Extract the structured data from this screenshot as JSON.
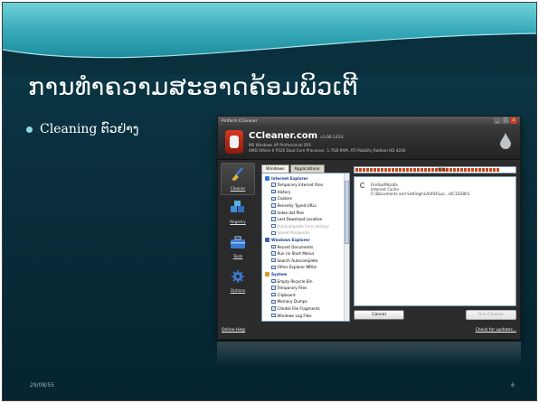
{
  "slide": {
    "title": "ການທຳຄວາມສະອາດຄ້ອມພິວເຕີ",
    "bullet": "Cleaning ຕົວຢ່າງ",
    "date": "29/08/55",
    "page_number": "6"
  },
  "app": {
    "title": "Piriform CCleaner",
    "brand": "CCleaner.com",
    "version": "v3.06.1433",
    "sysinfo_os": "MS Windows XP Professional SP3",
    "sysinfo_hw": "AMD Athlon II P320 Dual-Core Processor, 1.7GB RAM, ATI Mobility Radeon HD 4200",
    "window_buttons": [
      "_",
      "□",
      "x"
    ],
    "sidebar": [
      {
        "label": "Cleaner",
        "icon": "broom-icon",
        "active": true
      },
      {
        "label": "Registry",
        "icon": "registry-cubes-icon",
        "active": false
      },
      {
        "label": "Tools",
        "icon": "toolbox-icon",
        "active": false
      },
      {
        "label": "Options",
        "icon": "gear-icon",
        "active": false
      }
    ],
    "tabs": [
      "Windows",
      "Applications"
    ],
    "tree": [
      {
        "type": "group",
        "label": "Internet Explorer",
        "color": "#2f7bd6"
      },
      {
        "type": "item",
        "label": "Temporary Internet Files",
        "checked": true
      },
      {
        "type": "item",
        "label": "History",
        "checked": true
      },
      {
        "type": "item",
        "label": "Cookies",
        "checked": true
      },
      {
        "type": "item",
        "label": "Recently Typed URLs",
        "checked": true
      },
      {
        "type": "item",
        "label": "Index.dat files",
        "checked": true
      },
      {
        "type": "item",
        "label": "Last Download Location",
        "checked": true
      },
      {
        "type": "item",
        "label": "Autocomplete Form History",
        "checked": false
      },
      {
        "type": "item",
        "label": "Saved Passwords",
        "checked": false
      },
      {
        "type": "group",
        "label": "Windows Explorer",
        "color": "#3a5fb8"
      },
      {
        "type": "item",
        "label": "Recent Documents",
        "checked": true
      },
      {
        "type": "item",
        "label": "Run (in Start Menu)",
        "checked": true
      },
      {
        "type": "item",
        "label": "Search Autocomplete",
        "checked": true
      },
      {
        "type": "item",
        "label": "Other Explorer MRUs",
        "checked": true
      },
      {
        "type": "group",
        "label": "System",
        "color": "#d89a23"
      },
      {
        "type": "item",
        "label": "Empty Recycle Bin",
        "checked": true
      },
      {
        "type": "item",
        "label": "Temporary Files",
        "checked": true
      },
      {
        "type": "item",
        "label": "Clipboard",
        "checked": true
      },
      {
        "type": "item",
        "label": "Memory Dumps",
        "checked": true
      },
      {
        "type": "item",
        "label": "Chkdsk File Fragments",
        "checked": true
      },
      {
        "type": "item",
        "label": "Windows Log Files",
        "checked": true
      }
    ],
    "progress": {
      "percent": 91,
      "label": "91%"
    },
    "results": [
      "Firefox/Mozilla",
      "Internet Cache",
      "C:\\Documents and Settings\\LAURO\\Loc...\\4C1D2801"
    ],
    "cancel_label": "Cancel",
    "run_label": "Run Cleaner",
    "online_help": "Online Help",
    "check_updates": "Check for updates..."
  },
  "colors": {
    "slide_background": "#0a2f3d",
    "banner": "#37a9b8",
    "title_text": "#ffffff",
    "progress_fill": "#c6461c"
  }
}
